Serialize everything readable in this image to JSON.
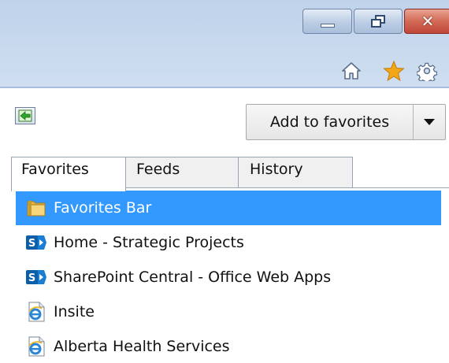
{
  "window": {
    "minimize_icon": "minimize-icon",
    "restore_icon": "restore-icon",
    "close_icon": "close-icon",
    "close_glyph": "✕"
  },
  "toolbar": {
    "icons": [
      "home-icon",
      "star-icon",
      "gear-icon"
    ],
    "star_color": "#f2a71a"
  },
  "panel": {
    "add_to_favorites_label": "Add to favorites",
    "tabs": [
      {
        "label": "Favorites",
        "active": true
      },
      {
        "label": "Feeds",
        "active": false
      },
      {
        "label": "History",
        "active": false
      }
    ],
    "items": [
      {
        "label": "Favorites Bar",
        "icon": "folder-icon",
        "selected": true
      },
      {
        "label": "Home - Strategic Projects",
        "icon": "sharepoint-icon",
        "selected": false
      },
      {
        "label": "SharePoint Central - Office Web Apps",
        "icon": "sharepoint-icon",
        "selected": false
      },
      {
        "label": "Insite",
        "icon": "ie-page-icon",
        "selected": false
      },
      {
        "label": "Alberta Health Services",
        "icon": "ie-page-icon",
        "selected": false
      }
    ]
  },
  "colors": {
    "selection": "#3399ff",
    "chrome": "#c9daee",
    "close_button": "#d26a55"
  }
}
